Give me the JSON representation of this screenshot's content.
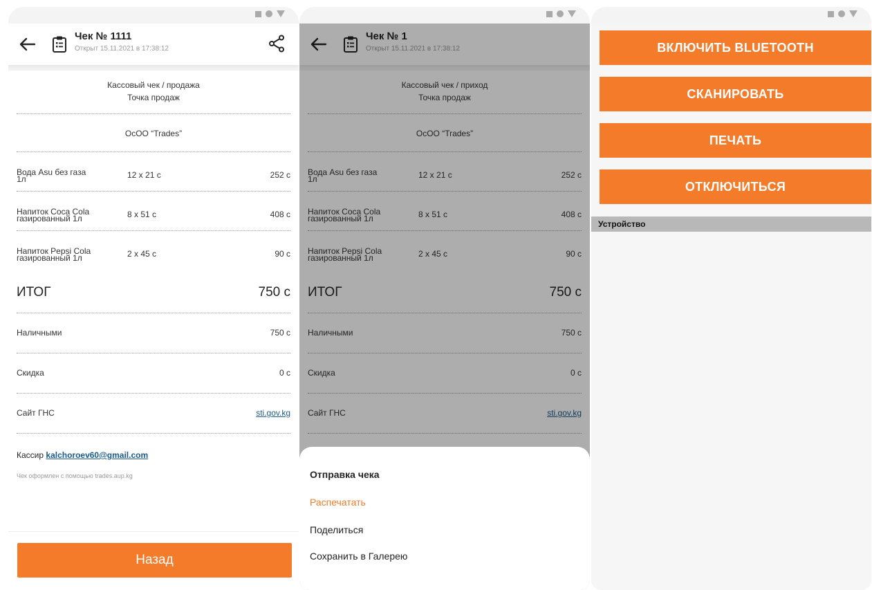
{
  "receipt1": {
    "title": "Чек № 1111",
    "subtitle": "Открыт 15.11.2021 в 17:38:12",
    "head_line1": "Кассовый чек / продажа",
    "head_line2": "Точка продаж",
    "org": "ОсОО  “Trades”",
    "items": [
      {
        "name_l1": "Вода Asu без газа",
        "name_l2": "1л",
        "qty": "12 х 21 с",
        "sum": "252 с"
      },
      {
        "name_l1": "Напиток Coca Cola",
        "name_l2": "газированный 1л",
        "qty": "8 х 51 с",
        "sum": "408 с"
      },
      {
        "name_l1": "Напиток Pepsi Cola",
        "name_l2": "газированный 1л",
        "qty": "2 х 45 с",
        "sum": "90 с"
      }
    ],
    "total_label": "ИТОГ",
    "total_value": "750 с",
    "cash_label": "Наличными",
    "cash_value": "750 с",
    "discount_label": "Скидка",
    "discount_value": "0 с",
    "site_label": "Сайт ГНС",
    "site_link": "sti.gov.kg",
    "cashier_label": "Кассир",
    "cashier_email": "kalchoroev60@gmail.com",
    "footer_note": "Чек оформлен с помощью trades.aup.kg",
    "back_button": "Назад"
  },
  "receipt2": {
    "title": "Чек № 1",
    "subtitle": "Открыт 15.11.2021 в 17:38:12",
    "head_line1": "Кассовый чек / приход",
    "head_line2": "Точка продаж",
    "org": "ОсОО  “Trades”",
    "items": [
      {
        "name_l1": "Вода Asu без газа",
        "name_l2": "1л",
        "qty": "12 х 21 с",
        "sum": "252 с"
      },
      {
        "name_l1": "Напиток Coca Cola",
        "name_l2": "газированный 1л",
        "qty": "8 х 51 с",
        "sum": "408 с"
      },
      {
        "name_l1": "Напиток Pepsi Cola",
        "name_l2": "газированный 1л",
        "qty": "2 х 45 с",
        "sum": "90 с"
      }
    ],
    "total_label": "ИТОГ",
    "total_value": "750 с",
    "cash_label": "Наличными",
    "cash_value": "750 с",
    "discount_label": "Скидка",
    "discount_value": "0 с",
    "site_label": "Сайт ГНС",
    "site_link": "sti.gov.kg"
  },
  "sheet": {
    "title": "Отправка чека",
    "print": "Распечатать",
    "share": "Поделиться",
    "save": "Сохранить в Галерею"
  },
  "printer": {
    "enable_bt": "ВКЛЮЧИТЬ BLUETOOTH",
    "scan": "СКАНИРОВАТЬ",
    "print": "ПЕЧАТЬ",
    "disconnect": "ОТКЛЮЧИТЬСЯ",
    "device_header": "Устройство"
  },
  "colors": {
    "accent": "#f47b2a",
    "link": "#1a5a8c"
  },
  "icons": [
    "back-arrow-icon",
    "receipt-document-icon",
    "share-icon",
    "status-bar-icons"
  ]
}
